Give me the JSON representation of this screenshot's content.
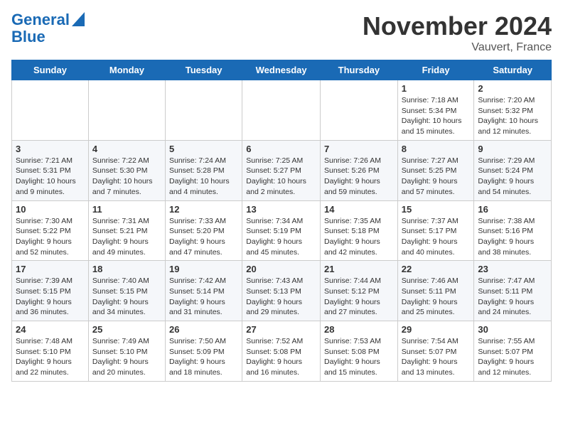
{
  "logo": {
    "line1": "General",
    "line2": "Blue"
  },
  "header": {
    "month": "November 2024",
    "location": "Vauvert, France"
  },
  "weekdays": [
    "Sunday",
    "Monday",
    "Tuesday",
    "Wednesday",
    "Thursday",
    "Friday",
    "Saturday"
  ],
  "weeks": [
    [
      {
        "day": "",
        "info": ""
      },
      {
        "day": "",
        "info": ""
      },
      {
        "day": "",
        "info": ""
      },
      {
        "day": "",
        "info": ""
      },
      {
        "day": "",
        "info": ""
      },
      {
        "day": "1",
        "info": "Sunrise: 7:18 AM\nSunset: 5:34 PM\nDaylight: 10 hours and 15 minutes."
      },
      {
        "day": "2",
        "info": "Sunrise: 7:20 AM\nSunset: 5:32 PM\nDaylight: 10 hours and 12 minutes."
      }
    ],
    [
      {
        "day": "3",
        "info": "Sunrise: 7:21 AM\nSunset: 5:31 PM\nDaylight: 10 hours and 9 minutes."
      },
      {
        "day": "4",
        "info": "Sunrise: 7:22 AM\nSunset: 5:30 PM\nDaylight: 10 hours and 7 minutes."
      },
      {
        "day": "5",
        "info": "Sunrise: 7:24 AM\nSunset: 5:28 PM\nDaylight: 10 hours and 4 minutes."
      },
      {
        "day": "6",
        "info": "Sunrise: 7:25 AM\nSunset: 5:27 PM\nDaylight: 10 hours and 2 minutes."
      },
      {
        "day": "7",
        "info": "Sunrise: 7:26 AM\nSunset: 5:26 PM\nDaylight: 9 hours and 59 minutes."
      },
      {
        "day": "8",
        "info": "Sunrise: 7:27 AM\nSunset: 5:25 PM\nDaylight: 9 hours and 57 minutes."
      },
      {
        "day": "9",
        "info": "Sunrise: 7:29 AM\nSunset: 5:24 PM\nDaylight: 9 hours and 54 minutes."
      }
    ],
    [
      {
        "day": "10",
        "info": "Sunrise: 7:30 AM\nSunset: 5:22 PM\nDaylight: 9 hours and 52 minutes."
      },
      {
        "day": "11",
        "info": "Sunrise: 7:31 AM\nSunset: 5:21 PM\nDaylight: 9 hours and 49 minutes."
      },
      {
        "day": "12",
        "info": "Sunrise: 7:33 AM\nSunset: 5:20 PM\nDaylight: 9 hours and 47 minutes."
      },
      {
        "day": "13",
        "info": "Sunrise: 7:34 AM\nSunset: 5:19 PM\nDaylight: 9 hours and 45 minutes."
      },
      {
        "day": "14",
        "info": "Sunrise: 7:35 AM\nSunset: 5:18 PM\nDaylight: 9 hours and 42 minutes."
      },
      {
        "day": "15",
        "info": "Sunrise: 7:37 AM\nSunset: 5:17 PM\nDaylight: 9 hours and 40 minutes."
      },
      {
        "day": "16",
        "info": "Sunrise: 7:38 AM\nSunset: 5:16 PM\nDaylight: 9 hours and 38 minutes."
      }
    ],
    [
      {
        "day": "17",
        "info": "Sunrise: 7:39 AM\nSunset: 5:15 PM\nDaylight: 9 hours and 36 minutes."
      },
      {
        "day": "18",
        "info": "Sunrise: 7:40 AM\nSunset: 5:15 PM\nDaylight: 9 hours and 34 minutes."
      },
      {
        "day": "19",
        "info": "Sunrise: 7:42 AM\nSunset: 5:14 PM\nDaylight: 9 hours and 31 minutes."
      },
      {
        "day": "20",
        "info": "Sunrise: 7:43 AM\nSunset: 5:13 PM\nDaylight: 9 hours and 29 minutes."
      },
      {
        "day": "21",
        "info": "Sunrise: 7:44 AM\nSunset: 5:12 PM\nDaylight: 9 hours and 27 minutes."
      },
      {
        "day": "22",
        "info": "Sunrise: 7:46 AM\nSunset: 5:11 PM\nDaylight: 9 hours and 25 minutes."
      },
      {
        "day": "23",
        "info": "Sunrise: 7:47 AM\nSunset: 5:11 PM\nDaylight: 9 hours and 24 minutes."
      }
    ],
    [
      {
        "day": "24",
        "info": "Sunrise: 7:48 AM\nSunset: 5:10 PM\nDaylight: 9 hours and 22 minutes."
      },
      {
        "day": "25",
        "info": "Sunrise: 7:49 AM\nSunset: 5:10 PM\nDaylight: 9 hours and 20 minutes."
      },
      {
        "day": "26",
        "info": "Sunrise: 7:50 AM\nSunset: 5:09 PM\nDaylight: 9 hours and 18 minutes."
      },
      {
        "day": "27",
        "info": "Sunrise: 7:52 AM\nSunset: 5:08 PM\nDaylight: 9 hours and 16 minutes."
      },
      {
        "day": "28",
        "info": "Sunrise: 7:53 AM\nSunset: 5:08 PM\nDaylight: 9 hours and 15 minutes."
      },
      {
        "day": "29",
        "info": "Sunrise: 7:54 AM\nSunset: 5:07 PM\nDaylight: 9 hours and 13 minutes."
      },
      {
        "day": "30",
        "info": "Sunrise: 7:55 AM\nSunset: 5:07 PM\nDaylight: 9 hours and 12 minutes."
      }
    ]
  ]
}
